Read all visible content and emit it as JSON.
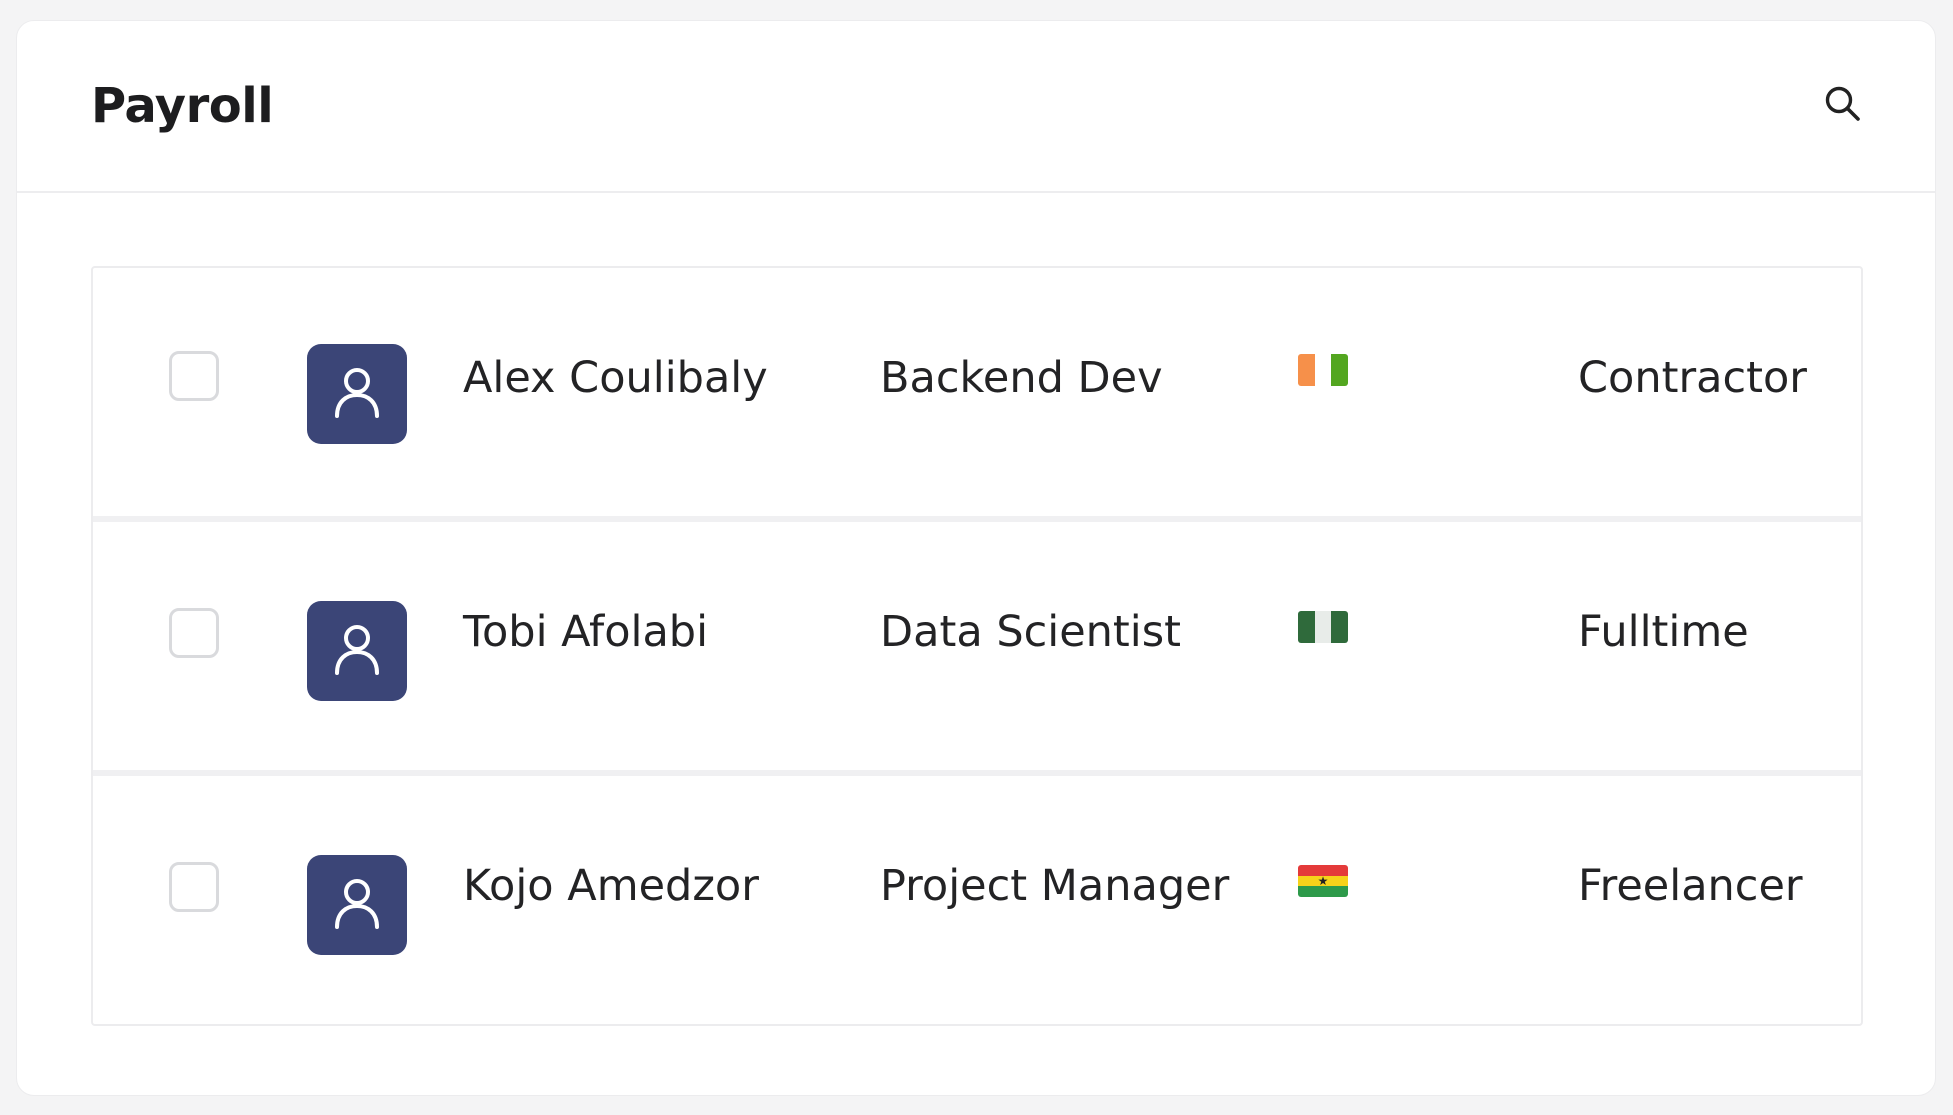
{
  "header": {
    "title": "Payroll",
    "search_icon": "search-icon"
  },
  "rows": [
    {
      "name": "Alex Coulibaly",
      "role": "Backend Dev",
      "flag": {
        "colors": [
          "#f6904a",
          "#ffffff",
          "#53a620"
        ],
        "orientation": "vertical"
      },
      "employment_type": "Contractor",
      "avatar_icon": "user-icon",
      "checked": false
    },
    {
      "name": "Tobi Afolabi",
      "role": "Data Scientist",
      "flag": {
        "colors": [
          "#2f6a3b",
          "#e8ece9",
          "#2f6a3b"
        ],
        "orientation": "vertical"
      },
      "employment_type": "Fulltime",
      "avatar_icon": "user-icon",
      "checked": false
    },
    {
      "name": "Kojo Amedzor",
      "role": "Project Manager",
      "flag": {
        "colors": [
          "#e43a3a",
          "#f6d21a",
          "#2d9a4a"
        ],
        "orientation": "horizontal"
      },
      "employment_type": "Freelancer",
      "avatar_icon": "user-icon",
      "checked": false
    }
  ],
  "colors": {
    "avatar_bg": "#3b4577",
    "border": "#ececee",
    "text": "#232325"
  }
}
